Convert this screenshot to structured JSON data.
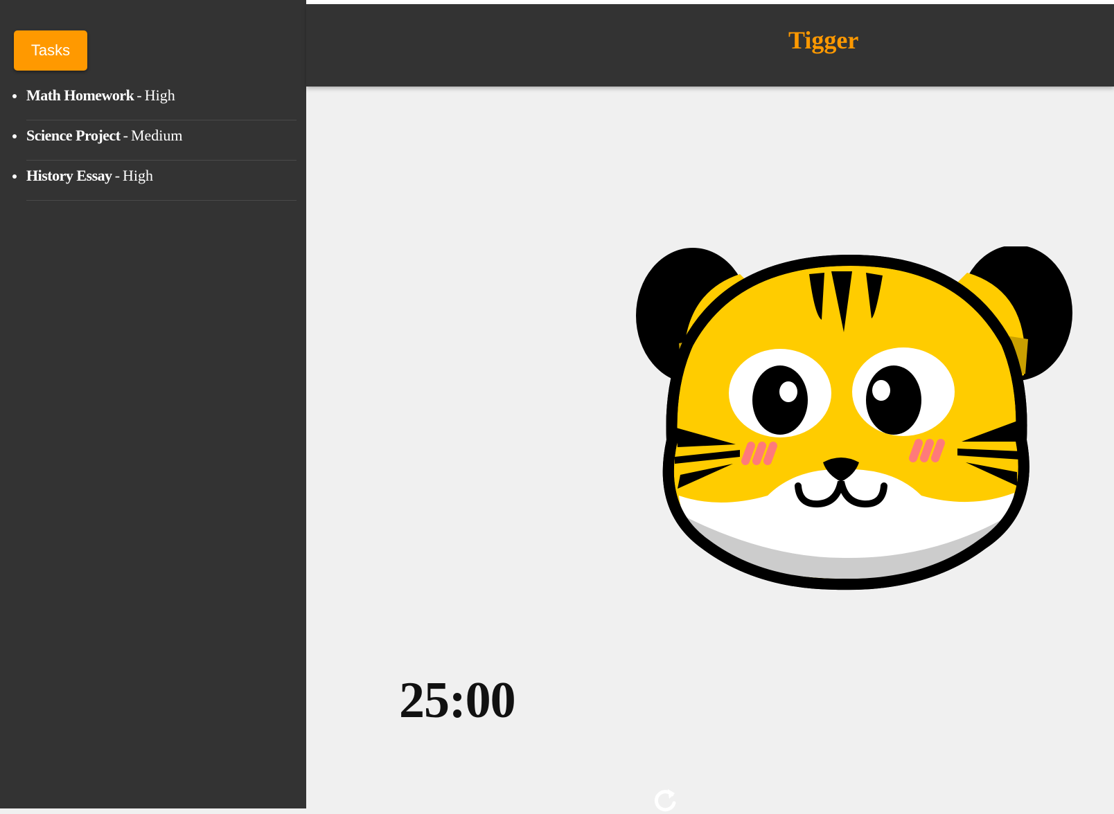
{
  "sidebar": {
    "toggle_label": "Tasks",
    "tasks": [
      {
        "name": "Math Homework",
        "priority": "High"
      },
      {
        "name": "Science Project",
        "priority": "Medium"
      },
      {
        "name": "History Essay",
        "priority": "High"
      }
    ],
    "separator": "-"
  },
  "header": {
    "title": "Tigger"
  },
  "main": {
    "mascot_icon": "tiger-face",
    "timer": "25:00",
    "reset_icon": "reset-icon"
  },
  "colors": {
    "accent": "#ff9900",
    "panel": "#333333",
    "background": "#f0f0f0"
  }
}
